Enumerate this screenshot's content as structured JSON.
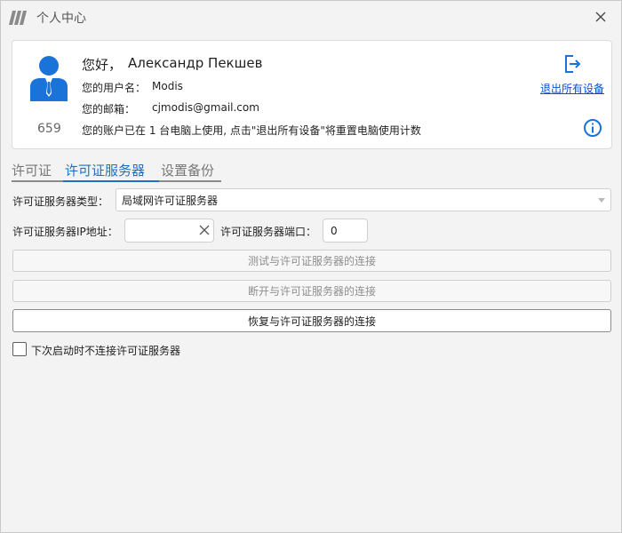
{
  "window": {
    "title": "个人中心",
    "close_icon": "close-icon",
    "logo_icon": "app-logo-icon"
  },
  "profile": {
    "avatar_icon": "user-avatar-icon",
    "greeting_label": "您好，",
    "greeting_name": "Александр Пекшев",
    "username_label": "您的用户名：",
    "username_value": "Modis",
    "email_label": "您的邮箱：",
    "email_value": "cjmodis@gmail.com",
    "user_id": "659",
    "usage_note": "您的账户已在 1 台电脑上使用, 点击\"退出所有设备\"将重置电脑使用计数",
    "logout_icon": "logout-icon",
    "logout_link": "退出所有设备",
    "info_icon": "info-icon",
    "accent_color": "#1a73d9"
  },
  "tabs": [
    {
      "label": "许可证",
      "active": false
    },
    {
      "label": "许可证服务器",
      "active": true
    },
    {
      "label": "设置备份",
      "active": false
    }
  ],
  "form": {
    "server_type_label": "许可证服务器类型：",
    "server_type_value": "局域网许可证服务器",
    "ip_label": "许可证服务器IP地址：",
    "ip_value": "",
    "port_label": "许可证服务器端口：",
    "port_value": "0",
    "test_button": "测试与许可证服务器的连接",
    "disconnect_button": "断开与许可证服务器的连接",
    "restore_button": "恢复与许可证服务器的连接",
    "no_connect_checkbox": "下次启动时不连接许可证服务器",
    "no_connect_checked": false
  }
}
